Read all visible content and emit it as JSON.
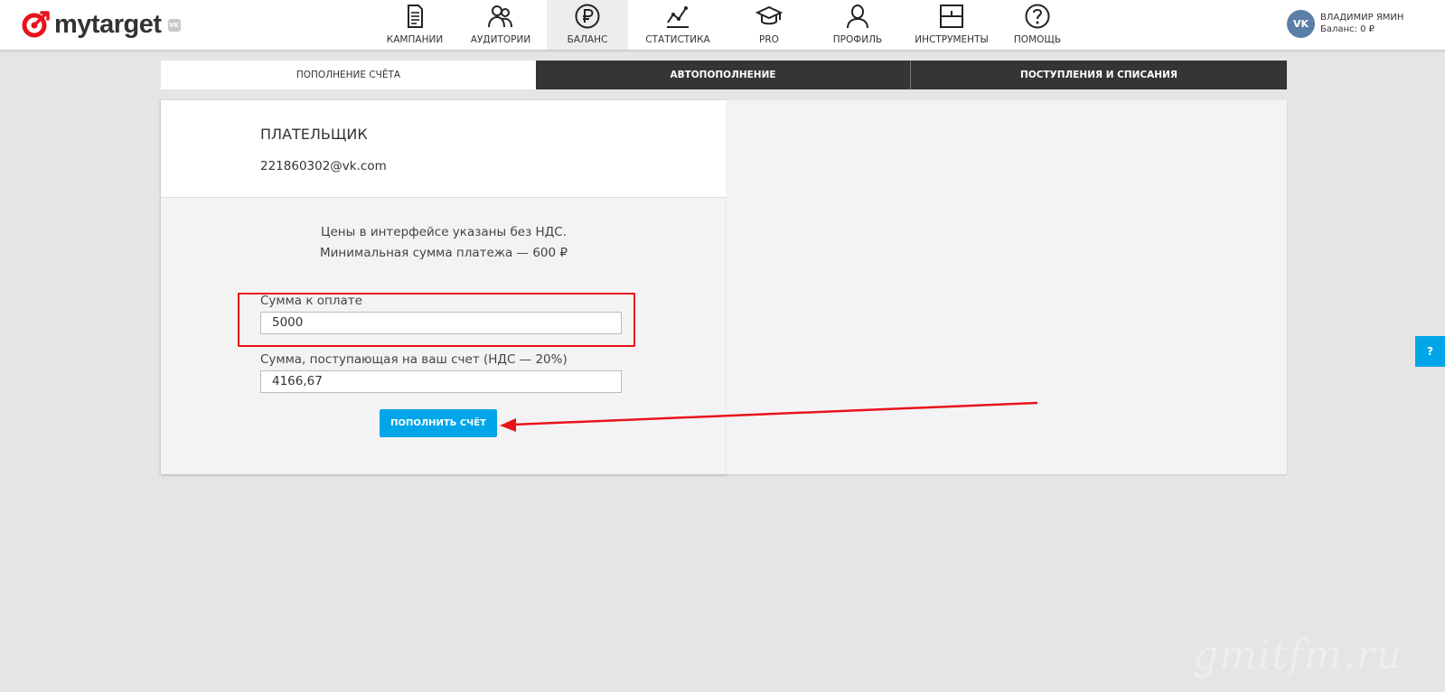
{
  "header": {
    "logo_text": "mytarget",
    "logo_vk": "VK",
    "nav": [
      {
        "label": "КАМПАНИИ",
        "icon": "document-icon"
      },
      {
        "label": "АУДИТОРИИ",
        "icon": "users-icon"
      },
      {
        "label": "БАЛАНС",
        "icon": "ruble-icon"
      },
      {
        "label": "СТАТИСТИКА",
        "icon": "chart-line-icon"
      },
      {
        "label": "PRO",
        "icon": "graduation-cap-icon"
      },
      {
        "label": "ПРОФИЛЬ",
        "icon": "person-icon"
      },
      {
        "label": "ИНСТРУМЕНТЫ",
        "icon": "tools-icon"
      },
      {
        "label": "ПОМОЩЬ",
        "icon": "question-icon"
      }
    ],
    "active_nav": "БАЛАНС",
    "user": {
      "avatar_text": "VK",
      "name": "ВЛАДИМИР ЯМИН",
      "balance": "Баланс: 0 ₽"
    }
  },
  "tabs": [
    {
      "label": "ПОПОЛНЕНИЕ СЧЁТА",
      "active": true
    },
    {
      "label": "АВТОПОПОЛНЕНИЕ",
      "active": false
    },
    {
      "label": "ПОСТУПЛЕНИЯ И СПИСАНИЯ",
      "active": false
    }
  ],
  "payer": {
    "title": "ПЛАТЕЛЬЩИК",
    "email": "221860302@vk.com"
  },
  "info": {
    "line1": "Цены в интерфейсе указаны без НДС.",
    "line2": "Минимальная сумма платежа — 600 ₽"
  },
  "form": {
    "amount_label": "Сумма к оплате",
    "amount_value": "5000",
    "received_label": "Сумма, поступающая на ваш счет (НДС — 20%)",
    "received_value": "4166,67",
    "submit_label": "ПОПОЛНИТЬ СЧЁТ"
  },
  "help_tab": "?",
  "watermark": "gmitfm.ru",
  "colors": {
    "accent": "#01a6e8",
    "annotation": "#e8131b",
    "tab_dark": "#353535",
    "logo_red": "#e8131b"
  }
}
